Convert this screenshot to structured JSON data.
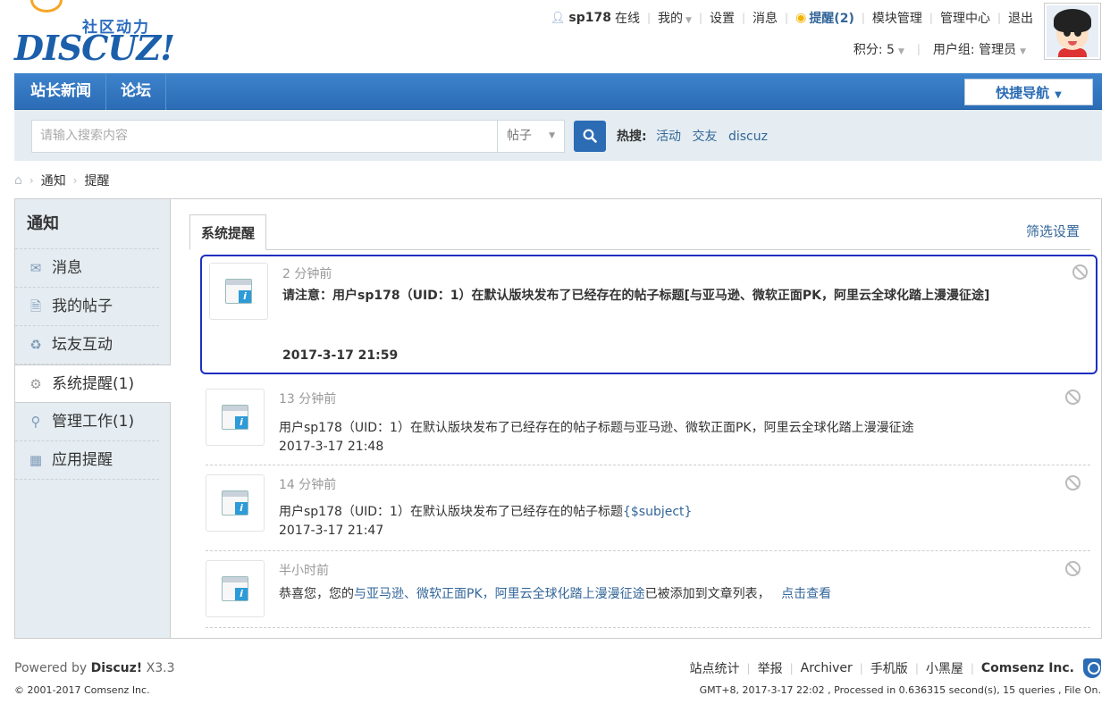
{
  "logo": {
    "tagline": "社区动力",
    "name": "DISCUZ!"
  },
  "topbar": {
    "username": "sp178",
    "online": "在线",
    "mine": "我的",
    "settings": "设置",
    "messages": "消息",
    "reminders": "提醒(2)",
    "module_manage": "模块管理",
    "admin_center": "管理中心",
    "logout": "退出",
    "points": "积分: 5",
    "usergroup": "用户组: 管理员"
  },
  "nav": {
    "items": [
      "站长新闻",
      "论坛"
    ],
    "quick_nav": "快捷导航"
  },
  "search": {
    "placeholder": "请输入搜索内容",
    "type": "帖子",
    "hot_label": "热搜:",
    "hot_items": [
      "活动",
      "交友",
      "discuz"
    ]
  },
  "breadcrumb": [
    "通知",
    "提醒"
  ],
  "sidebar": {
    "title": "通知",
    "items": [
      {
        "label": "消息",
        "icon": "envelope-icon"
      },
      {
        "label": "我的帖子",
        "icon": "document-icon"
      },
      {
        "label": "坛友互动",
        "icon": "recycle-icon"
      },
      {
        "label": "系统提醒(1)",
        "icon": "gear-icon"
      },
      {
        "label": "管理工作(1)",
        "icon": "wrench-icon"
      },
      {
        "label": "应用提醒",
        "icon": "grid-icon"
      }
    ]
  },
  "main": {
    "tab": "系统提醒",
    "filter": "筛选设置",
    "notices": [
      {
        "time": "2 分钟前",
        "message": "请注意：用户sp178（UID：1）在默认版块发布了已经存在的帖子标题[与亚马逊、微软正面PK，阿里云全球化踏上漫漫征途]",
        "date": "2017-3-17 21:59"
      },
      {
        "time": "13 分钟前",
        "message": "用户sp178（UID：1）在默认版块发布了已经存在的帖子标题与亚马逊、微软正面PK，阿里云全球化踏上漫漫征途",
        "date": "2017-3-17 21:48"
      },
      {
        "time": "14 分钟前",
        "message_prefix": "用户sp178（UID：1）在默认版块发布了已经存在的帖子标题",
        "message_link": "{$subject}",
        "date": "2017-3-17 21:47"
      },
      {
        "time": "半小时前",
        "message_prefix": "恭喜您，您的",
        "message_link": "与亚马逊、微软正面PK，阿里云全球化踏上漫漫征途",
        "message_mid": "已被添加到文章列表，",
        "view_link": "点击查看"
      }
    ]
  },
  "footer": {
    "powered_by": "Powered by",
    "product": "Discuz!",
    "version": "X3.3",
    "copyright": "© 2001-2017 Comsenz Inc.",
    "links": [
      "站点统计",
      "举报",
      "Archiver",
      "手机版",
      "小黑屋"
    ],
    "brand": "Comsenz Inc.",
    "stats": "GMT+8, 2017-3-17 22:02 , Processed in 0.636315 second(s), 15 queries , File On."
  },
  "colors": {
    "nav": "#2b6cb5",
    "link": "#336699",
    "highlight_border": "#1f2fbf",
    "sidebar_bg": "#e5edf2"
  }
}
